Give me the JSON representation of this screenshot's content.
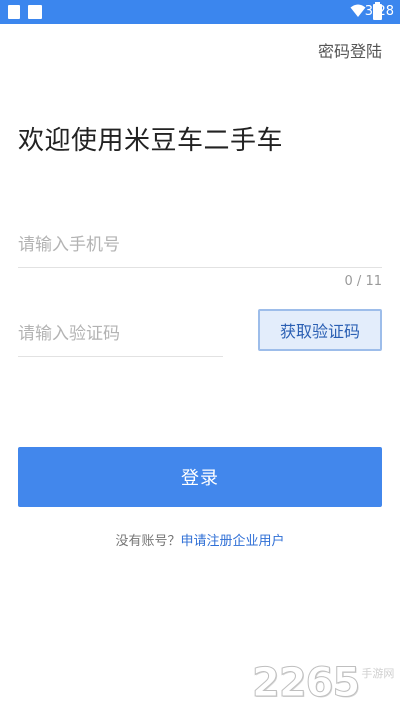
{
  "status_bar": {
    "time": "3:28",
    "background": "#3b86ee"
  },
  "header": {
    "password_login_link": "密码登陆"
  },
  "welcome": {
    "title": "欢迎使用米豆车二手车"
  },
  "phone": {
    "placeholder": "请输入手机号",
    "value": "",
    "counter": "0 / 11"
  },
  "code": {
    "placeholder": "请输入验证码",
    "value": "",
    "get_code_label": "获取验证码"
  },
  "login": {
    "label": "登录",
    "color": "#4287ec"
  },
  "register": {
    "question": "没有账号？",
    "link": "申请注册企业用户"
  },
  "watermark": {
    "number": "2265",
    "text": "手游网"
  }
}
